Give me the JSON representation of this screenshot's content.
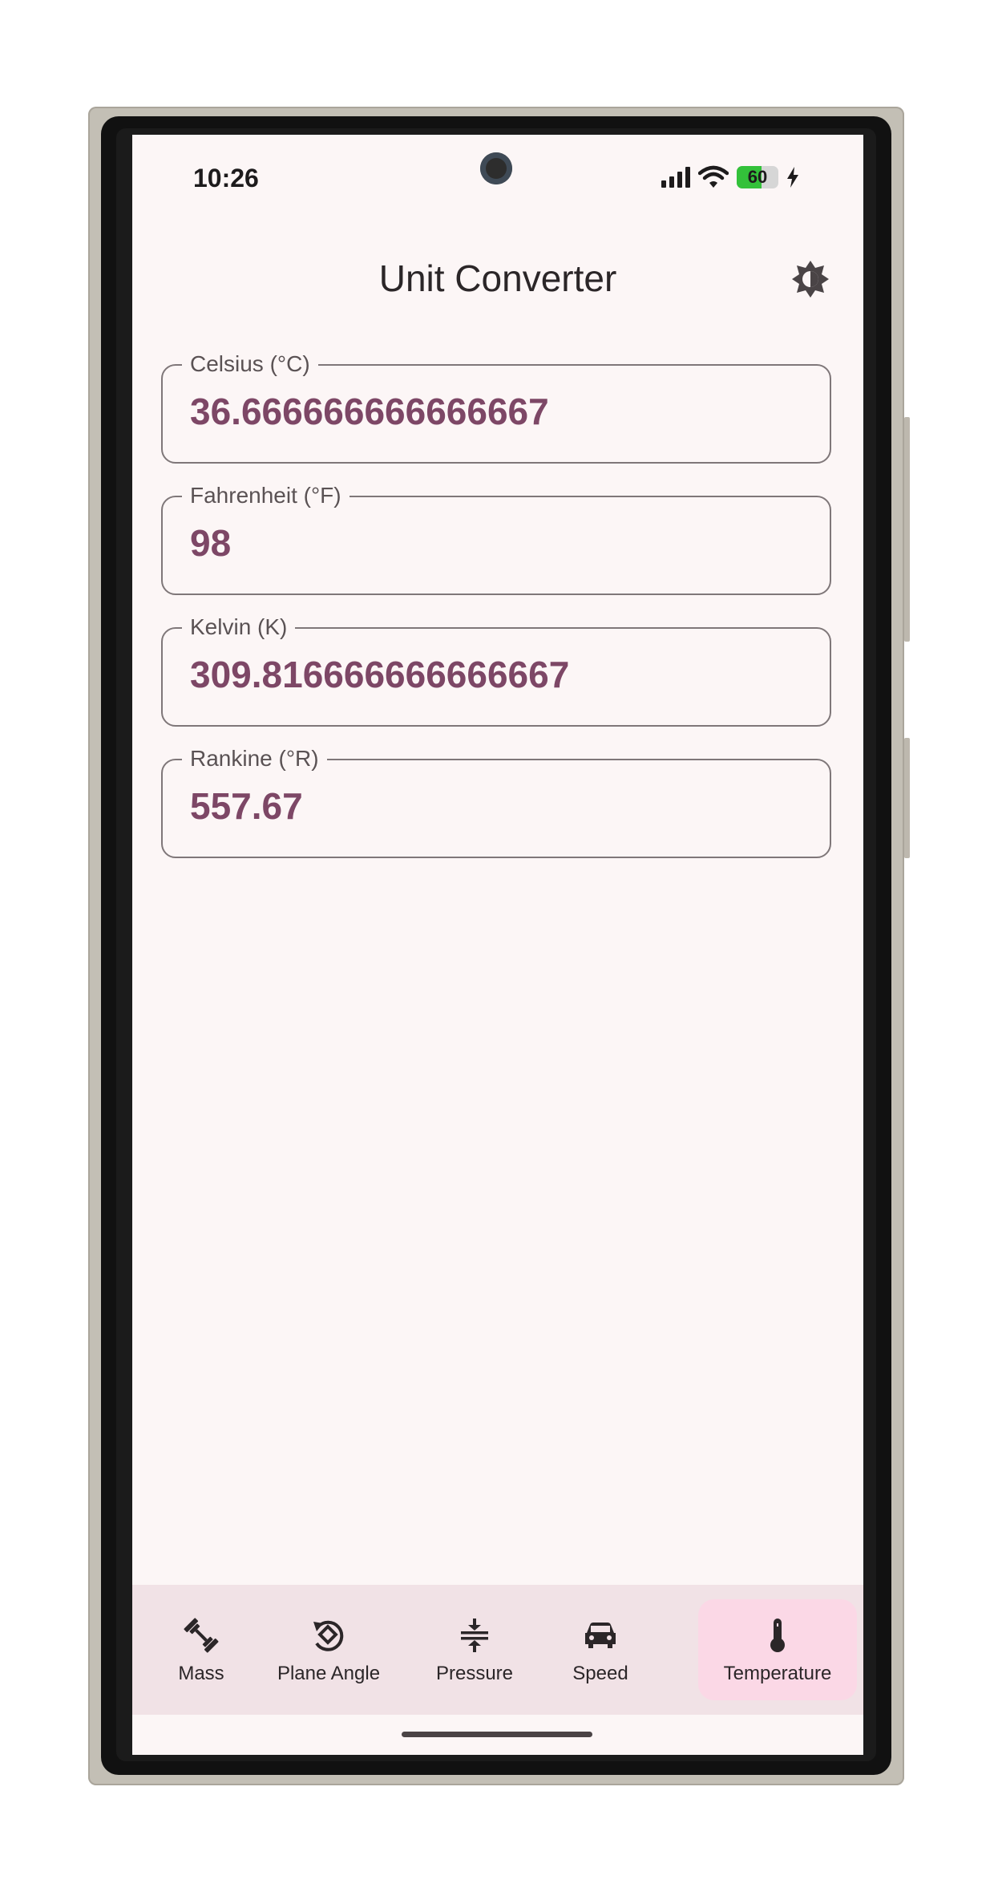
{
  "status_bar": {
    "time": "10:26",
    "battery": "60"
  },
  "app_bar": {
    "title": "Unit Converter",
    "theme_icon": "brightness-icon"
  },
  "fields": [
    {
      "label": "Celsius (°C)",
      "value": "36.666666666666667"
    },
    {
      "label": "Fahrenheit (°F)",
      "value": "98"
    },
    {
      "label": "Kelvin (K)",
      "value": "309.816666666666667"
    },
    {
      "label": "Rankine (°R)",
      "value": "557.67"
    }
  ],
  "nav": [
    {
      "label": "Mass",
      "icon": "dumbbell-icon",
      "selected": false
    },
    {
      "label": "Plane Angle",
      "icon": "rotate-angle-icon",
      "selected": false
    },
    {
      "label": "Pressure",
      "icon": "compress-icon",
      "selected": false
    },
    {
      "label": "Speed",
      "icon": "car-icon",
      "selected": false
    },
    {
      "label": "Temperature",
      "icon": "thermometer-icon",
      "selected": true
    }
  ],
  "colors": {
    "accent": "#7d4766",
    "screen_bg": "#fcf6f6",
    "nav_bg": "#f1e2e6",
    "nav_active": "#fbd8e6",
    "battery_green": "#33c13a"
  }
}
